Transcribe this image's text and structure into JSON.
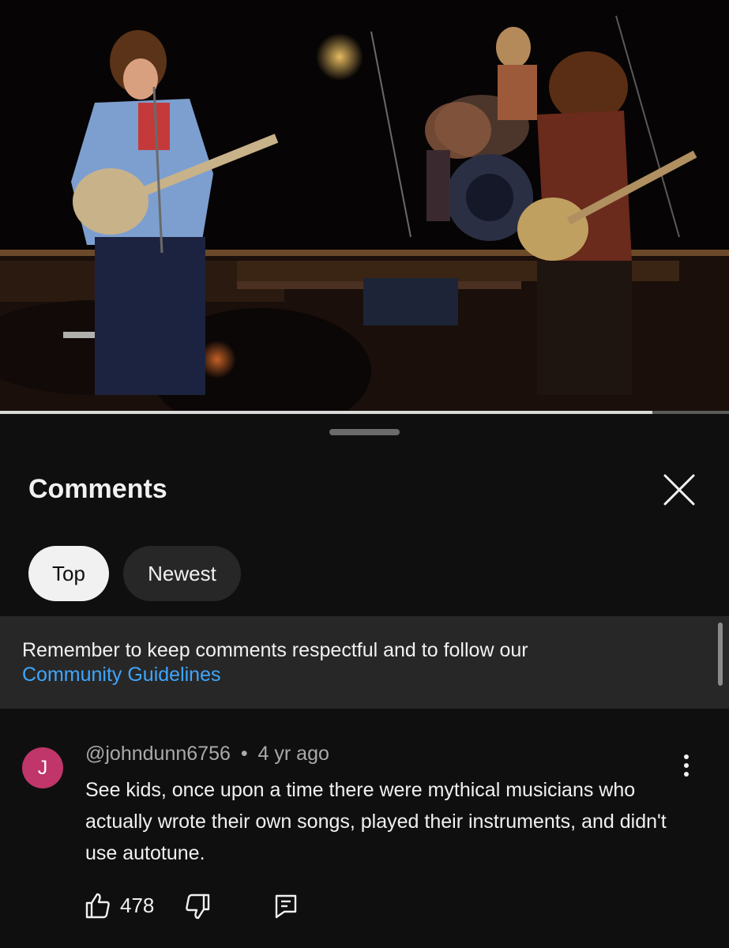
{
  "video": {
    "progress_fraction": 0.895
  },
  "sheet": {
    "title": "Comments",
    "close_icon": "close-icon",
    "chips": [
      {
        "label": "Top",
        "selected": true
      },
      {
        "label": "Newest",
        "selected": false
      }
    ],
    "notice": {
      "text": "Remember to keep comments respectful and to follow our",
      "link": "Community Guidelines"
    }
  },
  "comment": {
    "avatar_letter": "J",
    "avatar_color": "#c0356a",
    "author": "@johndunn6756",
    "separator": "•",
    "time": "4 yr ago",
    "text": "See kids, once upon a time there were mythical musicians who actually wrote their own songs, played their instruments, and didn't use autotune.",
    "like_count": "478",
    "icons": [
      "thumbs-up-icon",
      "thumbs-down-icon",
      "reply-icon",
      "more-vertical-icon"
    ]
  },
  "colors": {
    "background": "#0f0f0f",
    "surface": "#272727",
    "link": "#3ea6ff",
    "secondary_text": "#aaaaaa"
  }
}
